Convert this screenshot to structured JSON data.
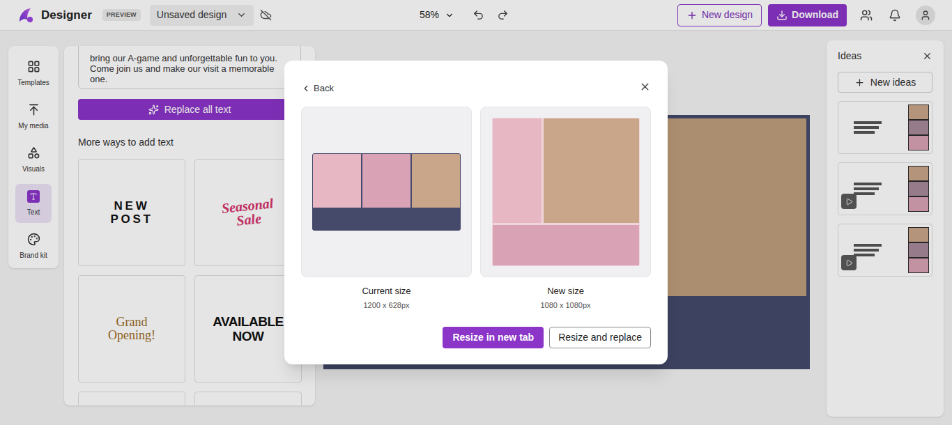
{
  "app": {
    "name": "Designer",
    "badge": "PREVIEW"
  },
  "document": {
    "title": "Unsaved design"
  },
  "zoom": "58%",
  "header_buttons": {
    "new_design": "New design",
    "download": "Download"
  },
  "rail": [
    {
      "label": "Templates",
      "selected": false
    },
    {
      "label": "My media",
      "selected": false
    },
    {
      "label": "Visuals",
      "selected": false
    },
    {
      "label": "Text",
      "selected": true
    },
    {
      "label": "Brand kit",
      "selected": false
    }
  ],
  "text_panel": {
    "body": "bring our A-game and unforgettable fun to you. Come join us and make our visit a memorable one.",
    "replace_button": "Replace all text",
    "section": "More ways to add text",
    "samples": [
      {
        "label": "NEW POST",
        "kind": "spaced"
      },
      {
        "label": "Seasonal Sale",
        "kind": "script"
      },
      {
        "label": "Grand Opening!",
        "kind": "serif"
      },
      {
        "label": "AVAILABLE NOW",
        "kind": "condensed"
      },
      {
        "label": "",
        "kind": "blank"
      },
      {
        "label": "",
        "kind": "blank"
      }
    ]
  },
  "ideas": {
    "title": "Ideas",
    "new_button": "New ideas",
    "items": [
      {
        "kind": "image"
      },
      {
        "kind": "video"
      },
      {
        "kind": "video"
      }
    ]
  },
  "dialog": {
    "back": "Back",
    "options": [
      {
        "label": "Current size",
        "size": "1200 x 628px",
        "kind": "landscape"
      },
      {
        "label": "New size",
        "size": "1080 x 1080px",
        "kind": "square"
      }
    ],
    "primary": "Resize in new tab",
    "secondary": "Resize and replace"
  }
}
